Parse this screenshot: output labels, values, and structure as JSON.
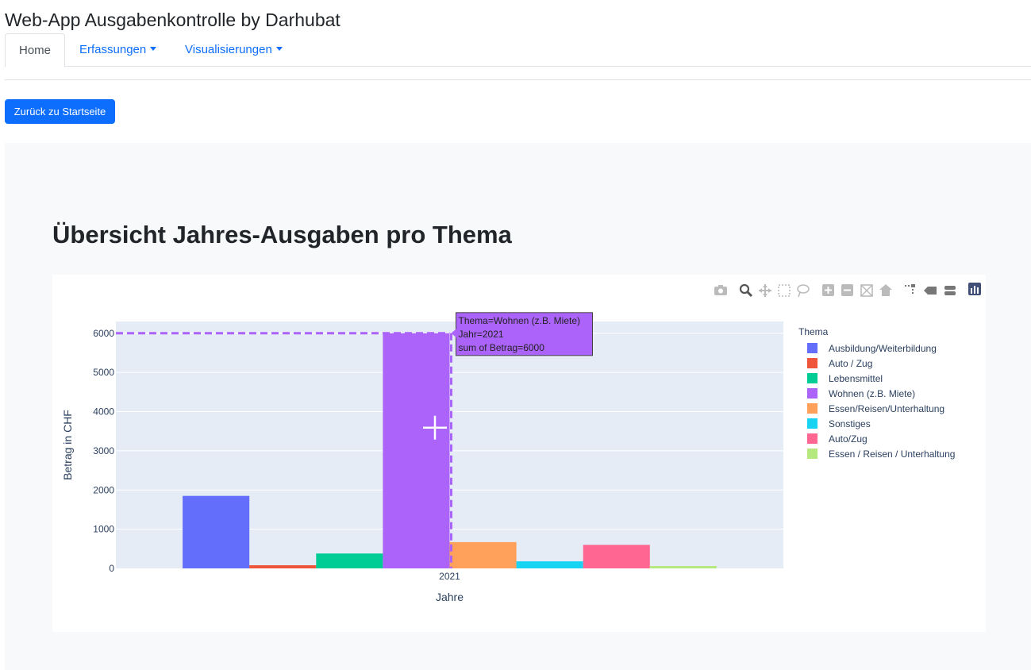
{
  "app": {
    "title": "Web-App Ausgabenkontrolle by Darhubat"
  },
  "nav": {
    "home": "Home",
    "erfassungen": "Erfassungen",
    "visualisierungen": "Visualisierungen"
  },
  "back_button": "Zurück zu Startseite",
  "page_title": "Übersicht Jahres-Ausgaben pro Thema",
  "toolbar_icons": [
    "camera-icon",
    "zoom-icon",
    "pan-icon",
    "box-select-icon",
    "lasso-icon",
    "zoom-in-icon",
    "zoom-out-icon",
    "autoscale-icon",
    "reset-axes-icon",
    "spike-lines-icon",
    "hover-closest-icon",
    "hover-compare-icon",
    "plotly-logo-icon"
  ],
  "hover": {
    "line1": "Thema=Wohnen (z.B. Miete)",
    "line2": "Jahr=2021",
    "line3": "sum of Betrag=6000"
  },
  "chart_data": {
    "type": "bar",
    "barmode": "group",
    "xlabel": "Jahre",
    "ylabel": "Betrag in CHF",
    "categories": [
      "2021"
    ],
    "ylim": [
      0,
      6300
    ],
    "yticks": [
      0,
      1000,
      2000,
      3000,
      4000,
      5000,
      6000
    ],
    "grid": true,
    "legend_title": "Thema",
    "legend_position": "right",
    "series": [
      {
        "name": "Ausbildung/Weiterbildung",
        "values": [
          1850
        ],
        "color": "#636efa"
      },
      {
        "name": "Auto / Zug",
        "values": [
          80
        ],
        "color": "#EF553B"
      },
      {
        "name": "Lebensmittel",
        "values": [
          380
        ],
        "color": "#00cc96"
      },
      {
        "name": "Wohnen (z.B. Miete)",
        "values": [
          6000
        ],
        "color": "#ab63fa"
      },
      {
        "name": "Essen/Reisen/Unterhaltung",
        "values": [
          670
        ],
        "color": "#FFA15A"
      },
      {
        "name": "Sonstiges",
        "values": [
          180
        ],
        "color": "#19d3f3"
      },
      {
        "name": "Auto/Zug",
        "values": [
          600
        ],
        "color": "#FF6692"
      },
      {
        "name": "Essen / Reisen / Unterhaltung",
        "values": [
          60
        ],
        "color": "#B6E880"
      }
    ]
  }
}
